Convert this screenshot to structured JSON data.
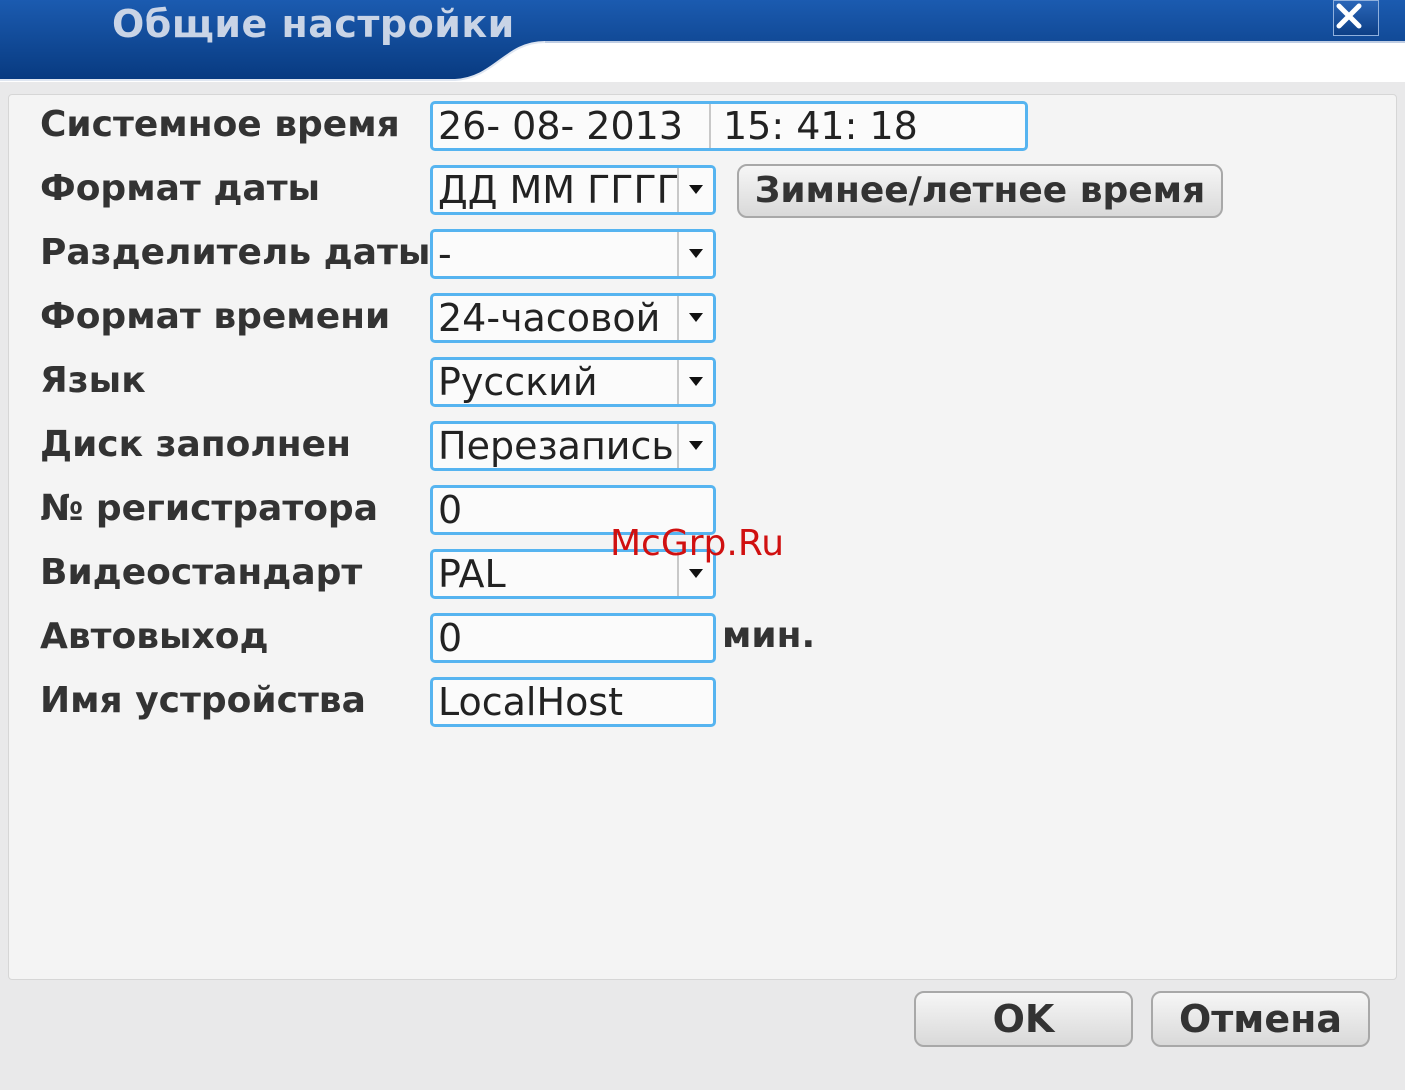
{
  "window": {
    "title": "Общие настройки",
    "close_symbol": "✕"
  },
  "fields": {
    "system_time": {
      "label": "Системное время",
      "date": "26- 08- 2013",
      "time": "15: 41: 18"
    },
    "date_format": {
      "label": "Формат даты",
      "value": "ДД ММ ГГГГ"
    },
    "date_separator": {
      "label": "Разделитель даты",
      "value": "-"
    },
    "time_format": {
      "label": "Формат времени",
      "value": "24-часовой"
    },
    "language": {
      "label": "Язык",
      "value": "Русский"
    },
    "disk_full": {
      "label": "Диск заполнен",
      "value": "Перезапись"
    },
    "recorder_no": {
      "label": "№ регистратора",
      "value": "0"
    },
    "video_standard": {
      "label": "Видеостандарт",
      "value": "PAL"
    },
    "auto_logout": {
      "label": "Автовыход",
      "value": "0",
      "unit": "мин."
    },
    "device_name": {
      "label": "Имя устройства",
      "value": "LocalHost"
    }
  },
  "buttons": {
    "dst": "Зимнее/летнее время",
    "ok": "OK",
    "cancel": "Отмена"
  },
  "watermark": "McGrp.Ru",
  "icons": {
    "dropdown": "triangle-down-icon",
    "close": "close-icon"
  },
  "colors": {
    "titlebar": "#0b4a9a",
    "field_border": "#56b4f0",
    "watermark": "#d01010"
  }
}
